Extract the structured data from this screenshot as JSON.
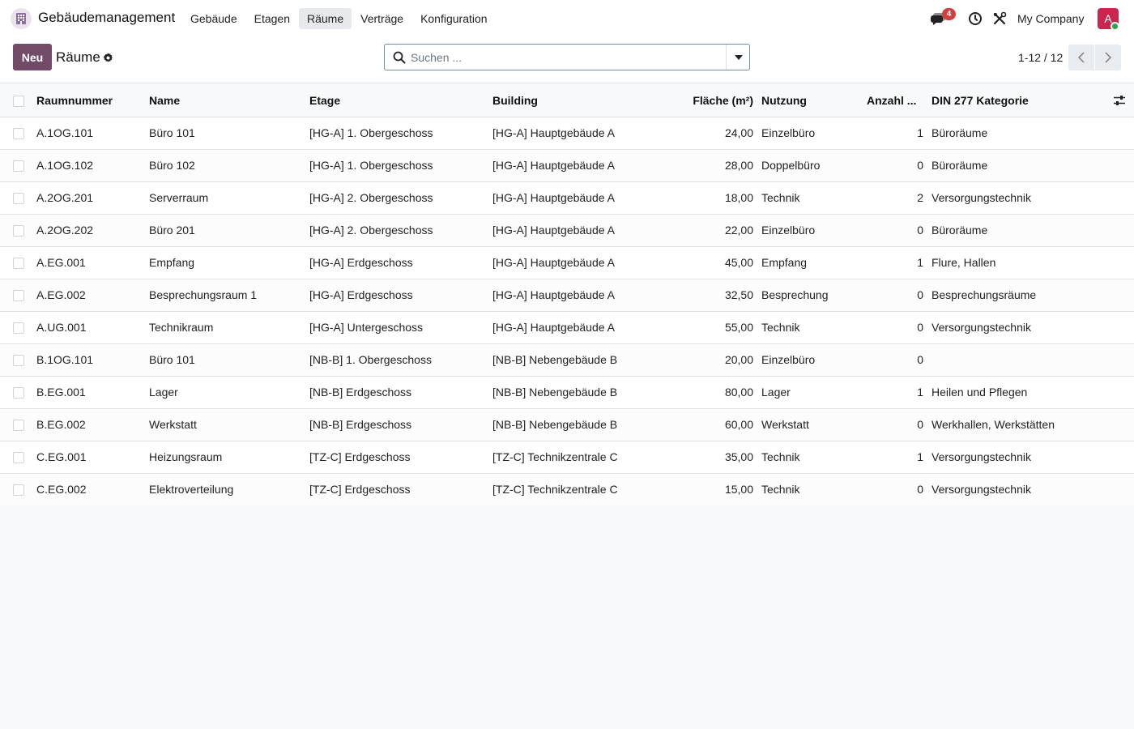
{
  "app": {
    "name": "Gebäudemanagement",
    "menu": [
      "Gebäude",
      "Etagen",
      "Räume",
      "Verträge",
      "Konfiguration"
    ],
    "active_menu": "Räume",
    "company": "My Company",
    "avatar_letter": "A",
    "chat_badge": "4",
    "colors": {
      "primary": "#714b67",
      "avatar": "#c8254f",
      "badge": "#d23f3f",
      "online": "#28a745"
    }
  },
  "control": {
    "new_label": "Neu",
    "title": "Räume",
    "search_placeholder": "Suchen ...",
    "pager": "1-12 / 12"
  },
  "table": {
    "columns": {
      "raumnummer": "Raumnummer",
      "name": "Name",
      "etage": "Etage",
      "building": "Building",
      "flaeche": "Fläche (m²)",
      "nutzung": "Nutzung",
      "anzahl": "Anzahl ...",
      "din": "DIN 277 Kategorie"
    },
    "rows": [
      {
        "raumnummer": "A.1OG.101",
        "name": "Büro 101",
        "etage": "[HG-A] 1. Obergeschoss",
        "building": "[HG-A] Hauptgebäude A",
        "flaeche": "24,00",
        "nutzung": "Einzelbüro",
        "anzahl": "1",
        "din": "Büroräume"
      },
      {
        "raumnummer": "A.1OG.102",
        "name": "Büro 102",
        "etage": "[HG-A] 1. Obergeschoss",
        "building": "[HG-A] Hauptgebäude A",
        "flaeche": "28,00",
        "nutzung": "Doppelbüro",
        "anzahl": "0",
        "din": "Büroräume"
      },
      {
        "raumnummer": "A.2OG.201",
        "name": "Serverraum",
        "etage": "[HG-A] 2. Obergeschoss",
        "building": "[HG-A] Hauptgebäude A",
        "flaeche": "18,00",
        "nutzung": "Technik",
        "anzahl": "2",
        "din": "Versorgungstechnik"
      },
      {
        "raumnummer": "A.2OG.202",
        "name": "Büro 201",
        "etage": "[HG-A] 2. Obergeschoss",
        "building": "[HG-A] Hauptgebäude A",
        "flaeche": "22,00",
        "nutzung": "Einzelbüro",
        "anzahl": "0",
        "din": "Büroräume"
      },
      {
        "raumnummer": "A.EG.001",
        "name": "Empfang",
        "etage": "[HG-A] Erdgeschoss",
        "building": "[HG-A] Hauptgebäude A",
        "flaeche": "45,00",
        "nutzung": "Empfang",
        "anzahl": "1",
        "din": "Flure, Hallen"
      },
      {
        "raumnummer": "A.EG.002",
        "name": "Besprechungsraum 1",
        "etage": "[HG-A] Erdgeschoss",
        "building": "[HG-A] Hauptgebäude A",
        "flaeche": "32,50",
        "nutzung": "Besprechung",
        "anzahl": "0",
        "din": "Besprechungsräume"
      },
      {
        "raumnummer": "A.UG.001",
        "name": "Technikraum",
        "etage": "[HG-A] Untergeschoss",
        "building": "[HG-A] Hauptgebäude A",
        "flaeche": "55,00",
        "nutzung": "Technik",
        "anzahl": "0",
        "din": "Versorgungstechnik"
      },
      {
        "raumnummer": "B.1OG.101",
        "name": "Büro 101",
        "etage": "[NB-B] 1. Obergeschoss",
        "building": "[NB-B] Nebengebäude B",
        "flaeche": "20,00",
        "nutzung": "Einzelbüro",
        "anzahl": "0",
        "din": ""
      },
      {
        "raumnummer": "B.EG.001",
        "name": "Lager",
        "etage": "[NB-B] Erdgeschoss",
        "building": "[NB-B] Nebengebäude B",
        "flaeche": "80,00",
        "nutzung": "Lager",
        "anzahl": "1",
        "din": "Heilen und Pflegen"
      },
      {
        "raumnummer": "B.EG.002",
        "name": "Werkstatt",
        "etage": "[NB-B] Erdgeschoss",
        "building": "[NB-B] Nebengebäude B",
        "flaeche": "60,00",
        "nutzung": "Werkstatt",
        "anzahl": "0",
        "din": "Werkhallen, Werkstätten"
      },
      {
        "raumnummer": "C.EG.001",
        "name": "Heizungsraum",
        "etage": "[TZ-C] Erdgeschoss",
        "building": "[TZ-C] Technikzentrale C",
        "flaeche": "35,00",
        "nutzung": "Technik",
        "anzahl": "1",
        "din": "Versorgungstechnik"
      },
      {
        "raumnummer": "C.EG.002",
        "name": "Elektroverteilung",
        "etage": "[TZ-C] Erdgeschoss",
        "building": "[TZ-C] Technikzentrale C",
        "flaeche": "15,00",
        "nutzung": "Technik",
        "anzahl": "0",
        "din": "Versorgungstechnik"
      }
    ]
  },
  "icons": {
    "logo": "building-icon",
    "chat": "chat-icon",
    "activity": "clock-icon",
    "debug": "tools-icon",
    "settings": "gear-icon",
    "search": "search-icon",
    "toggle": "caret-down-icon",
    "prev": "chevron-left-icon",
    "next": "chevron-right-icon",
    "optional_columns": "sliders-icon"
  }
}
